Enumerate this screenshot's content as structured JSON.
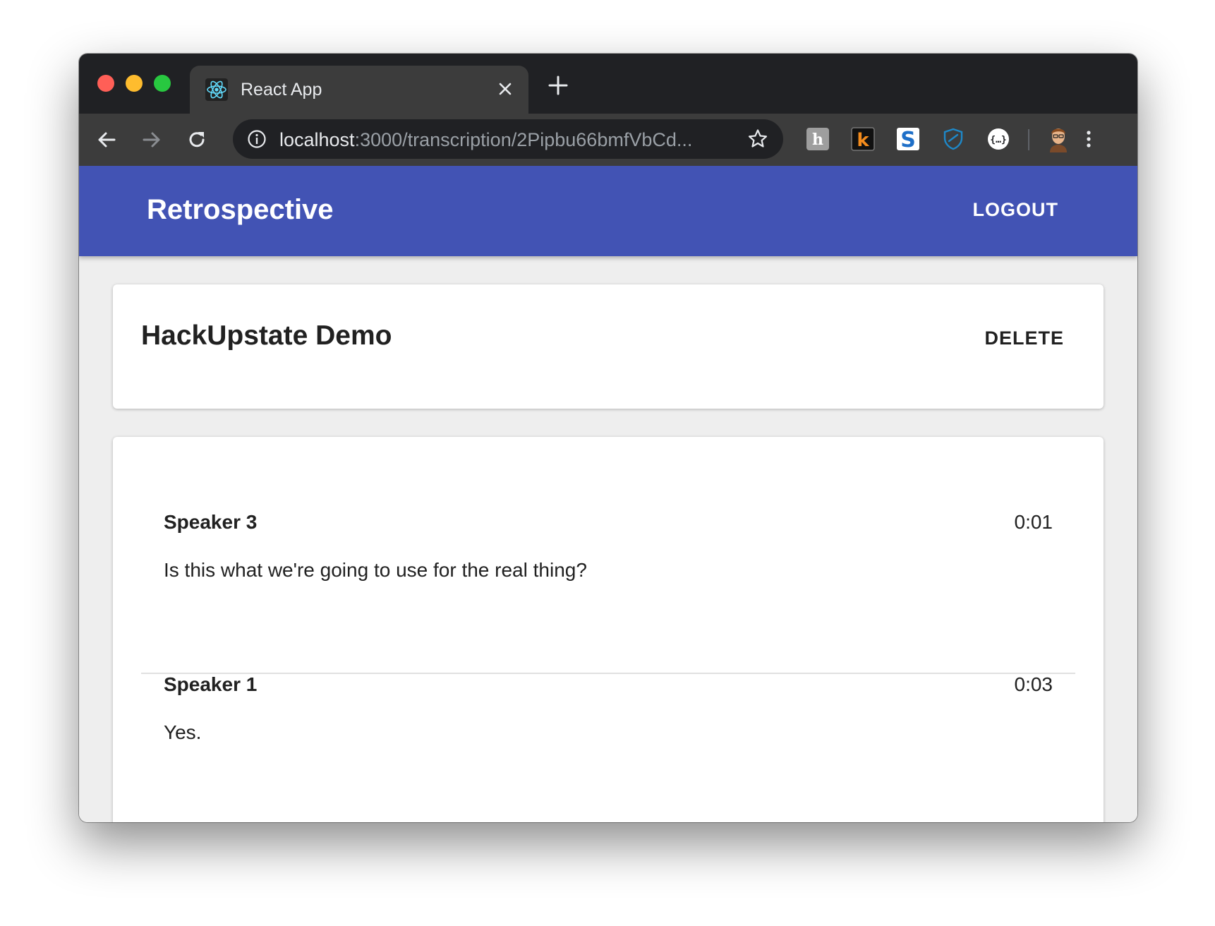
{
  "browser": {
    "tab_title": "React App",
    "url_host": "localhost",
    "url_rest": ":3000/transcription/2Pipbu66bmfVbCd..."
  },
  "colors": {
    "appbar": "#4253b4",
    "page_background": "#eeeeee",
    "text_primary": "#212121"
  },
  "appbar": {
    "title": "Retrospective",
    "logout_label": "LOGOUT"
  },
  "header_card": {
    "title": "HackUpstate Demo",
    "delete_label": "DELETE"
  },
  "transcript": {
    "entries": [
      {
        "speaker": "Speaker 3",
        "time": "0:01",
        "text": "Is this what we're going to use for the real thing?"
      },
      {
        "speaker": "Speaker 1",
        "time": "0:03",
        "text": "Yes."
      }
    ]
  }
}
